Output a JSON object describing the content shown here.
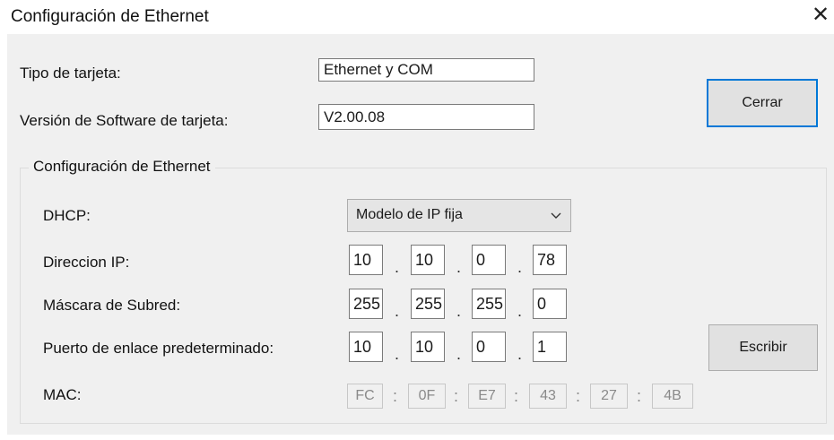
{
  "window": {
    "title": "Configuración de Ethernet",
    "close_glyph": "✕"
  },
  "card": {
    "type_label": "Tipo de tarjeta:",
    "type_value": "Ethernet y COM",
    "sw_label": "Versión de Software de tarjeta:",
    "sw_value": "V2.00.08"
  },
  "buttons": {
    "close": "Cerrar",
    "write": "Escribir"
  },
  "ethernet": {
    "group_title": "Configuración de Ethernet",
    "dhcp_label": "DHCP:",
    "dhcp_selected": "Modelo de IP fija",
    "ip_label": "Direccion IP:",
    "ip": [
      "10",
      "10",
      "0",
      "78"
    ],
    "mask_label": "Máscara de Subred:",
    "mask": [
      "255",
      "255",
      "255",
      "0"
    ],
    "gateway_label": "Puerto de enlace predeterminado:",
    "gateway": [
      "10",
      "10",
      "0",
      "1"
    ],
    "mac_label": "MAC:",
    "mac": [
      "FC",
      "0F",
      "E7",
      "43",
      "27",
      "4B"
    ],
    "ip_separator": ".",
    "mac_separator": ":"
  },
  "icons": {
    "close": "close-icon",
    "dropdown": "chevron-down-icon"
  },
  "colors": {
    "accent": "#0078d7",
    "client_bg": "#f0f0f0",
    "button_bg": "#e1e1e1"
  }
}
